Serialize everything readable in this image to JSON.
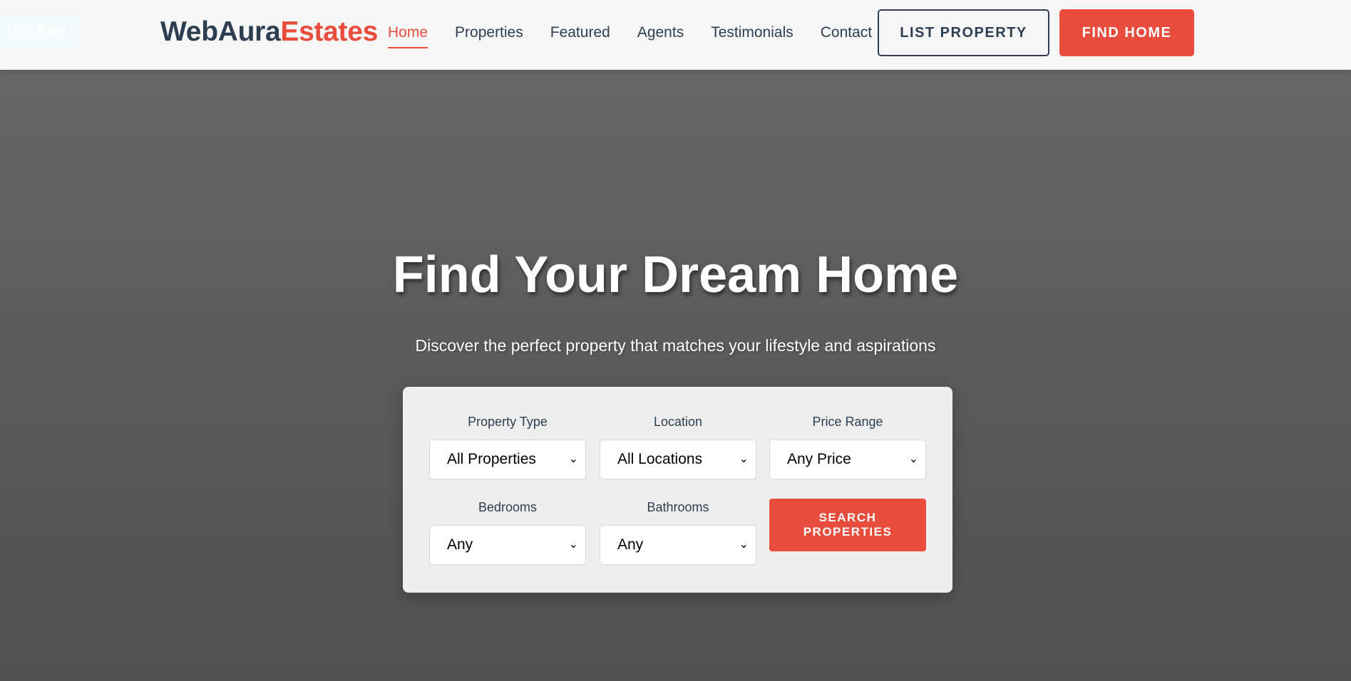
{
  "badge": {
    "text": "For Rent"
  },
  "header": {
    "logo_main": "WebAura",
    "logo_accent": "Estates",
    "nav": [
      "Home",
      "Properties",
      "Featured",
      "Agents",
      "Testimonials",
      "Contact"
    ],
    "active_nav": "Home",
    "list_property_label": "LIST PROPERTY",
    "find_home_label": "FIND HOME"
  },
  "hero": {
    "title": "Find Your Dream Home",
    "subtitle": "Discover the perfect property that matches your lifestyle and aspirations"
  },
  "search": {
    "property_type": {
      "label": "Property Type",
      "value": "All Properties"
    },
    "location": {
      "label": "Location",
      "value": "All Locations"
    },
    "price_range": {
      "label": "Price Range",
      "value": "Any Price"
    },
    "bedrooms": {
      "label": "Bedrooms",
      "value": "Any"
    },
    "bathrooms": {
      "label": "Bathrooms",
      "value": "Any"
    },
    "submit_label": "SEARCH PROPERTIES"
  },
  "colors": {
    "accent": "#e74c3c",
    "dark": "#2c3e50"
  }
}
